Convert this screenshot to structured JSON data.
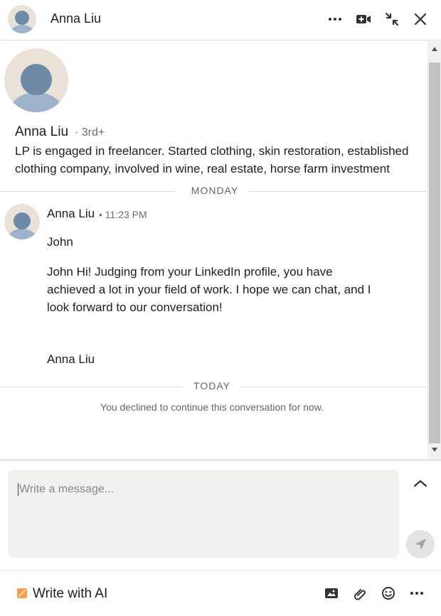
{
  "header": {
    "name": "Anna Liu",
    "icons": [
      "more-icon",
      "video-call-icon",
      "minimize-icon",
      "close-icon"
    ]
  },
  "profile": {
    "name": "Anna Liu",
    "degree": "· 3rd+",
    "headline": "LP is engaged in freelancer. Started clothing, skin restoration, established clothing company, involved in wine, real estate, horse farm investment"
  },
  "conversation": {
    "day1": "MONDAY",
    "message": {
      "sender": "Anna Liu",
      "time": "• 11:23 PM",
      "greeting": "John",
      "body": "John Hi! Judging from your LinkedIn profile, you have achieved a lot in your field of work. I hope we can chat, and I look forward to our conversation!",
      "signoff": "Anna Liu"
    },
    "day2": "TODAY",
    "status": "You declined to continue this conversation for now."
  },
  "composer": {
    "placeholder": "Write a message..."
  },
  "footer": {
    "ai_label": "Write with AI",
    "icons": [
      "image-icon",
      "attach-icon",
      "emoji-icon",
      "more-icon"
    ]
  },
  "colors": {
    "avatar_bg": "#e8e2d9",
    "avatar_head": "#6f8aa6",
    "avatar_body": "#9cb3c9",
    "composer_bg": "#f3f1ed",
    "ai_icon": "#f0a050"
  }
}
